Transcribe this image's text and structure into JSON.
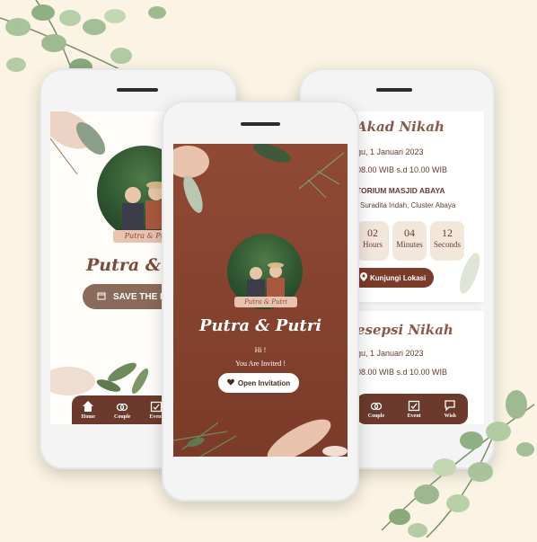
{
  "left_phone": {
    "couple_names": "Putra & Putri",
    "ribbon_text": "Putra & Putri",
    "save_button": "SAVE THE DATE",
    "nav": [
      "Home",
      "Couple",
      "Event"
    ]
  },
  "center_phone": {
    "couple_names": "Putra & Putri",
    "ribbon_text": "Putra & Putri",
    "greeting": "Hi !",
    "invited_text": "You Are Invited !",
    "open_button": "Open Invitation"
  },
  "right_phone": {
    "akad": {
      "title": "Akad Nikah",
      "date": "gu, 1 Januari 2023",
      "time": "08.00 WIB s.d 10.00 WIB",
      "venue": "TORIUM MASJID ABAYA",
      "address": "Suradita Indah, Cluster Abaya"
    },
    "countdown": [
      {
        "value": "02",
        "label": "Hours"
      },
      {
        "value": "04",
        "label": "Minutes"
      },
      {
        "value": "12",
        "label": "Seconds"
      }
    ],
    "location_button": "Kunjungi Lokasi",
    "resepsi": {
      "title": "esepsi Nikah",
      "date": "gu, 1 Januari 2023",
      "time": "08.00 WIB s.d 10.00 WIB"
    },
    "nav": [
      "Couple",
      "Event",
      "Wish"
    ]
  },
  "colors": {
    "background": "#fbf4e4",
    "brand_brown": "#7b3b29",
    "accent_peach": "#e7c3b0"
  }
}
